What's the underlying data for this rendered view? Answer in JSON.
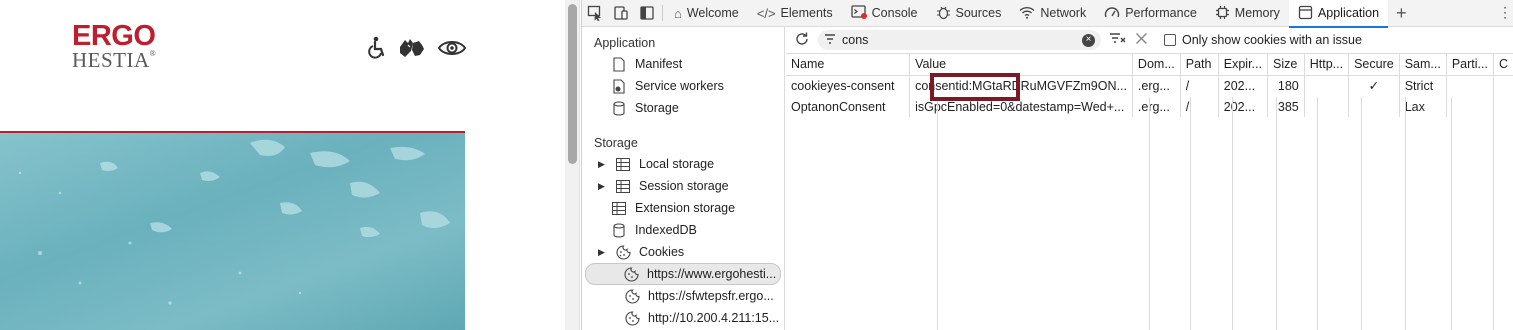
{
  "webpage": {
    "logo": {
      "line1": "ERGO",
      "line2": "HESTIA",
      "reg": "®"
    },
    "a11y_icons": [
      "wheelchair-icon",
      "sign-language-icon",
      "eye-icon"
    ],
    "hero_color": "#6ab1bd",
    "accent_color": "#bf1e2e"
  },
  "devtools": {
    "tabs": {
      "welcome": "Welcome",
      "elements": "Elements",
      "console": "Console",
      "sources": "Sources",
      "network": "Network",
      "performance": "Performance",
      "memory": "Memory",
      "application": "Application"
    },
    "sidebar": {
      "application_title": "Application",
      "manifest": "Manifest",
      "service_workers": "Service workers",
      "storage_item": "Storage",
      "storage_title": "Storage",
      "local_storage": "Local storage",
      "session_storage": "Session storage",
      "extension_storage": "Extension storage",
      "indexeddb": "IndexedDB",
      "cookies": "Cookies",
      "cookie_origins": [
        "https://www.ergohesti...",
        "https://sfwtepsfr.ergo...",
        "http://10.200.4.211:15..."
      ]
    },
    "toolbar": {
      "filter_value": "cons",
      "only_issue_label": "Only show cookies with an issue"
    },
    "table": {
      "headers": [
        "Name",
        "Value",
        "Dom...",
        "Path",
        "Expir...",
        "Size",
        "Http...",
        "Secure",
        "Sam...",
        "Parti...",
        "C"
      ],
      "rows": [
        [
          "cookieyes-consent",
          "consentid:MGtaRDRuMGVFZm9ON...",
          ".erg...",
          "/",
          "202...",
          "180",
          "",
          "✓",
          "Strict",
          "",
          ""
        ],
        [
          "OptanonConsent",
          "isGpcEnabled=0&datestamp=Wed+...",
          ".erg...",
          "/",
          "202...",
          "385",
          "",
          "",
          "Lax",
          "",
          ""
        ]
      ]
    }
  }
}
